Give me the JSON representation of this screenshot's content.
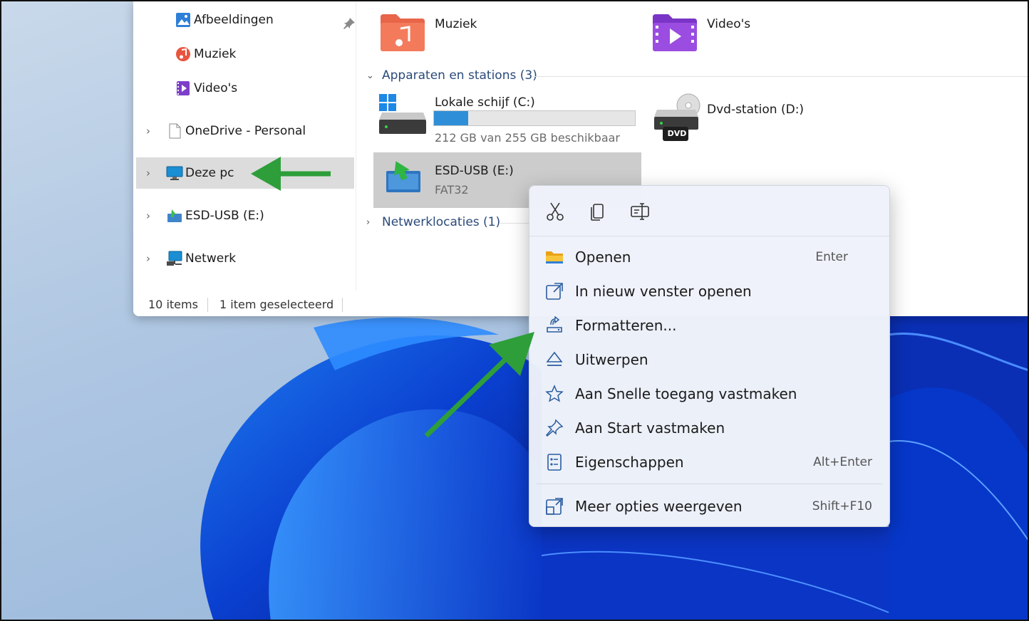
{
  "nav_pane": {
    "items": [
      {
        "label": "Afbeeldingen",
        "icon": "pictures-icon"
      },
      {
        "label": "Muziek",
        "icon": "music-icon"
      },
      {
        "label": "Video's",
        "icon": "videos-icon"
      },
      {
        "label": "OneDrive - Personal",
        "icon": "onedrive-icon"
      },
      {
        "label": "Deze pc",
        "icon": "this-pc-icon"
      },
      {
        "label": "ESD-USB (E:)",
        "icon": "usb-drive-icon"
      },
      {
        "label": "Netwerk",
        "icon": "network-icon"
      }
    ]
  },
  "content": {
    "folders": [
      {
        "label": "Muziek",
        "icon": "music-folder-icon"
      },
      {
        "label": "Video's",
        "icon": "videos-folder-icon"
      }
    ],
    "devices_header": "Apparaten en stations (3)",
    "drives": [
      {
        "label": "Lokale schijf (C:)",
        "sub": "212 GB van 255 GB beschikbaar",
        "used_fraction": 0.17,
        "icon": "windows-drive-icon"
      },
      {
        "label": "Dvd-station (D:)",
        "badge": "DVD",
        "icon": "dvd-drive-icon"
      },
      {
        "label": "ESD-USB (E:)",
        "sub": "FAT32",
        "icon": "usb-drive-icon"
      }
    ],
    "network_header": "Netwerklocaties (1)"
  },
  "status_bar": {
    "count": "10 items",
    "selected": "1 item geselecteerd"
  },
  "context_menu": {
    "toolbar": [
      {
        "name": "cut",
        "icon": "scissors-icon"
      },
      {
        "name": "copy",
        "icon": "copy-icon"
      },
      {
        "name": "rename",
        "icon": "rename-icon"
      }
    ],
    "items": [
      {
        "label": "Openen",
        "shortcut": "Enter",
        "icon": "folder-open-icon"
      },
      {
        "label": "In nieuw venster openen",
        "shortcut": "",
        "icon": "open-new-window-icon"
      },
      {
        "label": "Formatteren...",
        "shortcut": "",
        "icon": "format-icon"
      },
      {
        "label": "Uitwerpen",
        "shortcut": "",
        "icon": "eject-icon"
      },
      {
        "label": "Aan Snelle toegang vastmaken",
        "shortcut": "",
        "icon": "star-icon"
      },
      {
        "label": "Aan Start vastmaken",
        "shortcut": "",
        "icon": "pin-icon"
      },
      {
        "label": "Eigenschappen",
        "shortcut": "Alt+Enter",
        "icon": "properties-icon"
      },
      {
        "label": "Meer opties weergeven",
        "shortcut": "Shift+F10",
        "icon": "more-options-icon"
      }
    ]
  },
  "colors": {
    "accent": "#2e8fd8",
    "arrow": "#2e9e3a",
    "selection": "#dcdcdc"
  }
}
